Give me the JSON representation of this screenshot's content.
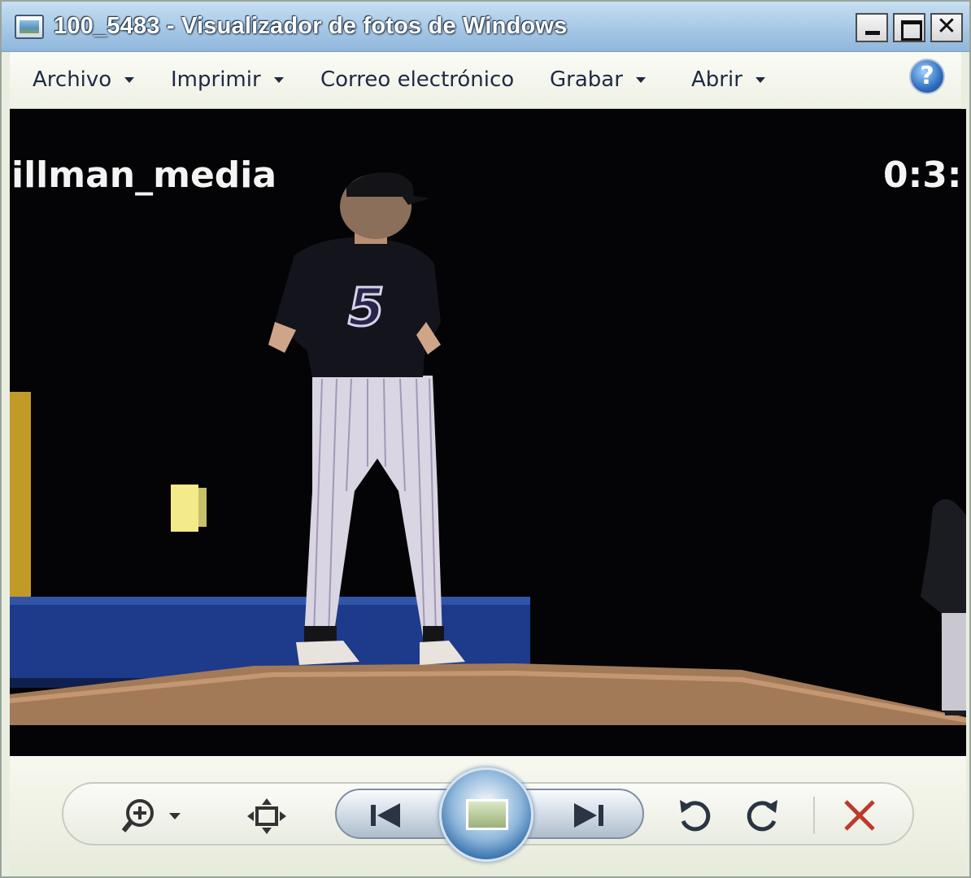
{
  "window": {
    "title": "100_5483 - Visualizador de fotos de Windows",
    "caption_buttons": {
      "minimize": "_",
      "maximize": "□",
      "close": "✕"
    }
  },
  "menu": {
    "items": [
      {
        "label": "Archivo",
        "has_dropdown": true
      },
      {
        "label": "Imprimir",
        "has_dropdown": true
      },
      {
        "label": "Correo electrónico",
        "has_dropdown": false
      },
      {
        "label": "Grabar",
        "has_dropdown": true
      },
      {
        "label": "Abrir",
        "has_dropdown": true
      }
    ],
    "help_label": "?"
  },
  "photo": {
    "watermark_text": "illman_media",
    "timestamp_text": "0:3:",
    "jersey_number": "5"
  },
  "controls": {
    "icons": [
      "zoom-icon",
      "fit-to-window-icon",
      "previous-icon",
      "slideshow-icon",
      "next-icon",
      "rotate-counterclockwise-icon",
      "rotate-clockwise-icon",
      "delete-icon"
    ]
  },
  "colors": {
    "titlebar": "#a7c8e6",
    "menu_text": "#1e2a44",
    "delete_icon": "#c0392b",
    "control_glass": "#2e69a8"
  }
}
